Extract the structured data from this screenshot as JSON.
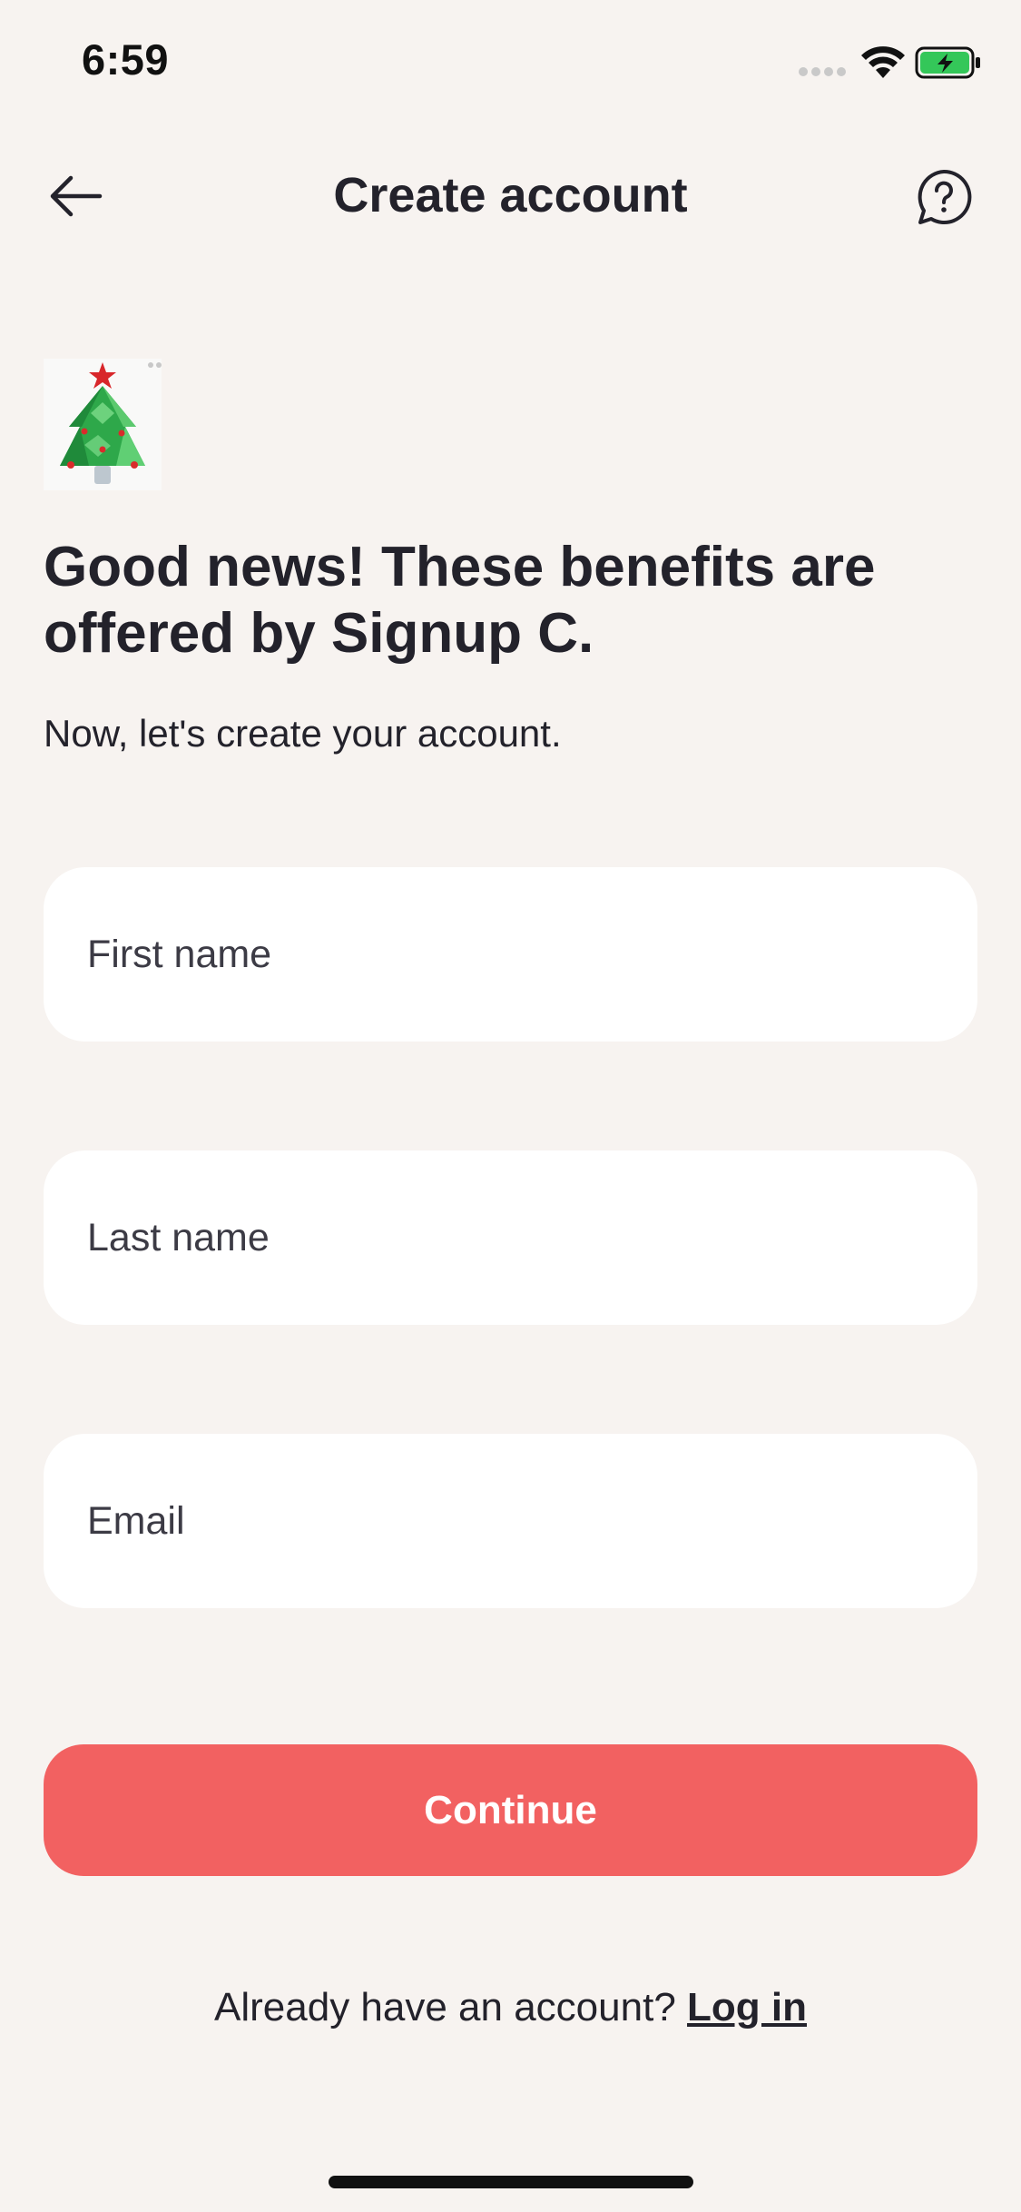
{
  "status_bar": {
    "time": "6:59",
    "battery_color": "#34c759"
  },
  "header": {
    "title": "Create account",
    "back_icon": "arrow-left-icon",
    "help_icon": "question-bubble-icon"
  },
  "logo": {
    "icon": "christmas-tree-icon"
  },
  "content": {
    "headline": "Good news! These benefits are offered by Signup C.",
    "subtext": "Now, let's create your account."
  },
  "form": {
    "first_name": {
      "placeholder": "First name",
      "value": ""
    },
    "last_name": {
      "placeholder": "Last name",
      "value": ""
    },
    "email": {
      "placeholder": "Email",
      "value": ""
    }
  },
  "actions": {
    "continue_label": "Continue",
    "continue_color": "#f26161"
  },
  "footer": {
    "prompt": "Already have an account?",
    "login_label": "Log in"
  }
}
